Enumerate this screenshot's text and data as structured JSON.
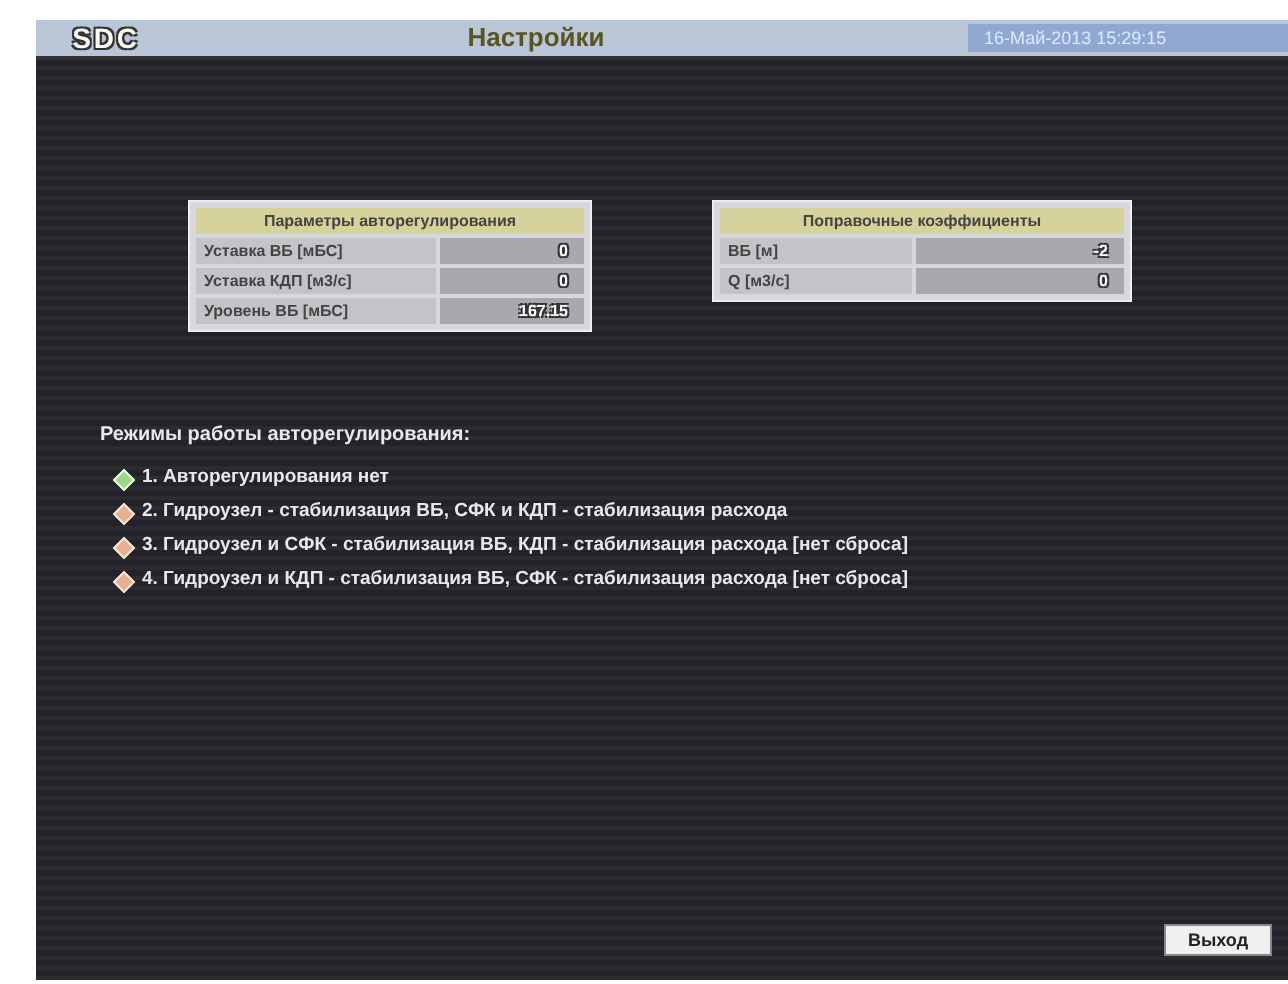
{
  "header": {
    "logo": "SDC",
    "title": "Настройки",
    "datetime": "16-Май-2013 15:29:15"
  },
  "tables": [
    {
      "title": "Параметры авторегулирования",
      "rows": [
        {
          "label": "Уставка ВБ [мБС]",
          "value": "0"
        },
        {
          "label": "Уставка КДП [м3/с]",
          "value": "0"
        },
        {
          "label": "Уровень ВБ [мБС]",
          "value": "167.15"
        }
      ]
    },
    {
      "title": "Поправочные коэффициенты",
      "rows": [
        {
          "label": "ВБ [м]",
          "value": "-2"
        },
        {
          "label": "Q [м3/с]",
          "value": "0"
        }
      ]
    }
  ],
  "modes": {
    "heading": "Режимы работы авторегулирования:",
    "items": [
      {
        "label": "1. Авторегулирования нет",
        "selected": true
      },
      {
        "label": "2. Гидроузел - стабилизация ВБ, СФК и КДП - стабилизация расхода",
        "selected": false
      },
      {
        "label": "3. Гидроузел и СФК - стабилизация ВБ, КДП - стабилизация расхода [нет сброса]",
        "selected": false
      },
      {
        "label": "4. Гидроузел и КДП - стабилизация ВБ, СФК - стабилизация расхода [нет сброса]",
        "selected": false
      }
    ]
  },
  "exit_button": "Выход"
}
